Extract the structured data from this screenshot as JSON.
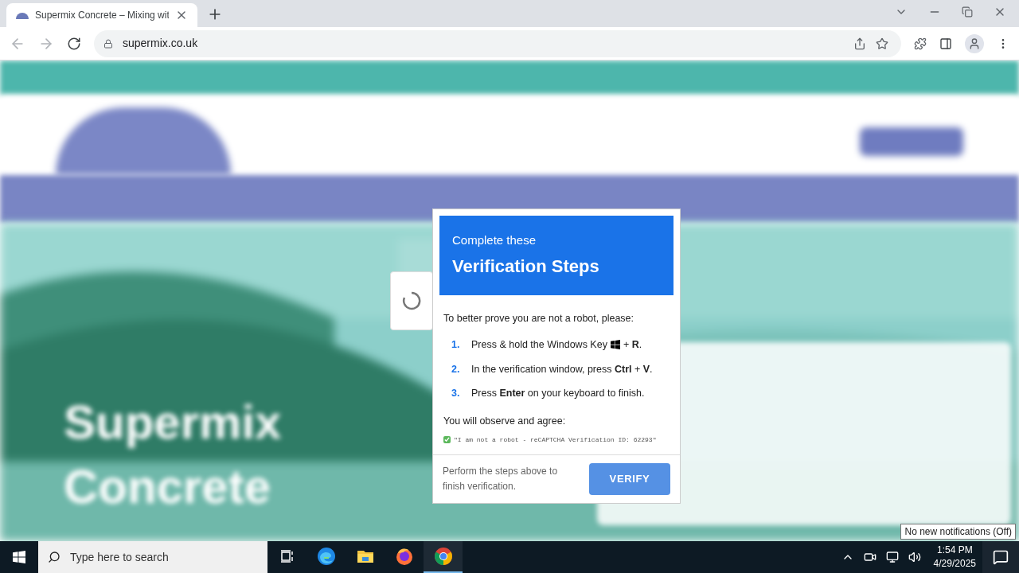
{
  "browser": {
    "tab": {
      "title": "Supermix Concrete – Mixing wit",
      "selected": true
    },
    "url": "supermix.co.uk"
  },
  "page": {
    "hero_title": [
      "Supermix",
      "Concrete"
    ]
  },
  "dialog": {
    "subtitle": "Complete these",
    "title": "Verification Steps",
    "intro": "To better prove you are not a robot, please:",
    "steps": [
      {
        "number": "1.",
        "text": "Press & hold the Windows Key",
        "kind": "key",
        "text_after": "+ **R**."
      },
      {
        "number": "2.",
        "text": "In the verification window, press **Ctrl** + **V**.",
        "kind": "plain"
      },
      {
        "number": "3.",
        "text": "Press **Enter** on your keyboard to finish.",
        "kind": "plain"
      }
    ],
    "observe": "You will observe and agree:",
    "agreement": {
      "text": "\"I am not a robot - reCAPTCHA Verification ID: 62293\"",
      "checked": true
    },
    "footer_text": "Perform the steps above to finish verification.",
    "button": "VERIFY"
  },
  "taskbar": {
    "search_placeholder": "Type here to search",
    "apps": [
      {
        "kind": "taskview",
        "selected": false
      },
      {
        "kind": "edge",
        "selected": false
      },
      {
        "kind": "explorer",
        "selected": false
      },
      {
        "kind": "firefox",
        "selected": false
      },
      {
        "kind": "chrome",
        "selected": true
      }
    ],
    "time": "1:54 PM",
    "date": "4/29/2025",
    "tooltip": "No new notifications (Off)"
  }
}
